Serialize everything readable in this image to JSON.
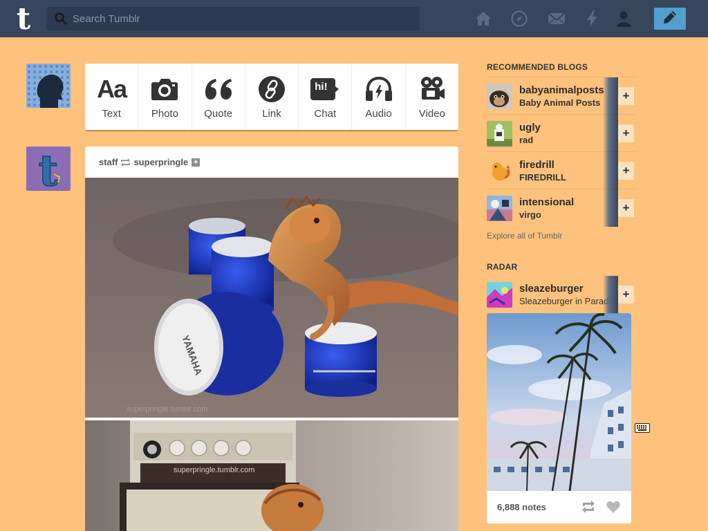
{
  "header": {
    "logo": "t",
    "search_placeholder": "Search Tumblr",
    "nav_icons": [
      "home-icon",
      "explore-compass-icon",
      "inbox-mail-icon",
      "activity-lightning-icon",
      "account-person-icon"
    ],
    "compose_icon": "pencil-icon"
  },
  "post_types": [
    {
      "label": "Text",
      "icon": "text-aa-icon",
      "glyph": "Aa"
    },
    {
      "label": "Photo",
      "icon": "camera-icon"
    },
    {
      "label": "Quote",
      "icon": "quote-icon",
      "glyph": "“"
    },
    {
      "label": "Link",
      "icon": "link-icon"
    },
    {
      "label": "Chat",
      "icon": "chat-bubble-icon",
      "glyph": "hi!"
    },
    {
      "label": "Audio",
      "icon": "headphones-icon"
    },
    {
      "label": "Video",
      "icon": "video-camera-icon"
    }
  ],
  "post": {
    "author": "staff",
    "reblogged_from": "superpringle",
    "follow_glyph": "+",
    "watermark": "superpringle.tumblr.com"
  },
  "sidebar": {
    "recommended_title": "RECOMMENDED BLOGS",
    "blogs": [
      {
        "name": "babyanimalposts",
        "title": "Baby Animal Posts"
      },
      {
        "name": "ugly",
        "title": "rad"
      },
      {
        "name": "firedrill",
        "title": "FIREDRILL"
      },
      {
        "name": "intensional",
        "title": "virgo"
      }
    ],
    "explore_link": "Explore all of Tumblr",
    "radar_title": "RADAR",
    "radar": {
      "name": "sleazeburger",
      "title": "Sleazeburger in Paradise",
      "notes": "6,888 notes"
    },
    "plus_glyph": "+"
  },
  "colors": {
    "background": "#fec27d",
    "header": "#36465d",
    "compose": "#529ecc"
  }
}
